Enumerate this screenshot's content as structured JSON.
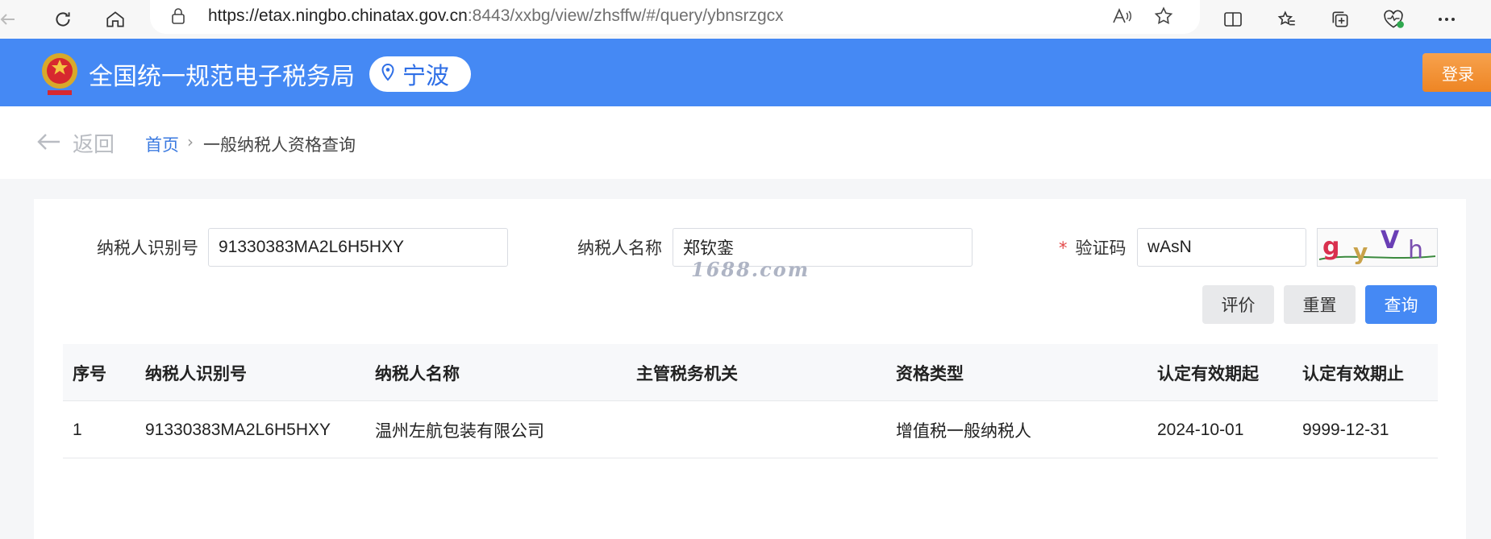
{
  "browser": {
    "url_host": "https://etax.ningbo.chinatax.gov.cn",
    "url_rest": ":8443/xxbg/view/zhsffw/#/query/ybnsrzgcx"
  },
  "header": {
    "title": "全国统一规范电子税务局",
    "city": "宁波",
    "login_label": "登录",
    "brand_color": "#4589f4"
  },
  "breadcrumb": {
    "back_label": "返回",
    "home": "首页",
    "separator": "›",
    "current": "一般纳税人资格查询"
  },
  "form": {
    "taxpayer_id_label": "纳税人识别号",
    "taxpayer_id_value": "91330383MA2L6H5HXY",
    "taxpayer_name_label": "纳税人名称",
    "taxpayer_name_value": "郑钦銮",
    "captcha_required": "*",
    "captcha_label": "验证码",
    "captcha_value": "wAsN",
    "captcha_image_text": "gyVh"
  },
  "watermark": "1688.com",
  "buttons": {
    "evaluate": "评价",
    "reset": "重置",
    "query": "查询"
  },
  "table": {
    "headers": [
      "序号",
      "纳税人识别号",
      "纳税人名称",
      "主管税务机关",
      "资格类型",
      "认定有效期起",
      "认定有效期止"
    ],
    "rows": [
      [
        "1",
        "91330383MA2L6H5HXY",
        "温州左航包装有限公司",
        "",
        "增值税一般纳税人",
        "2024-10-01",
        "9999-12-31"
      ]
    ]
  }
}
